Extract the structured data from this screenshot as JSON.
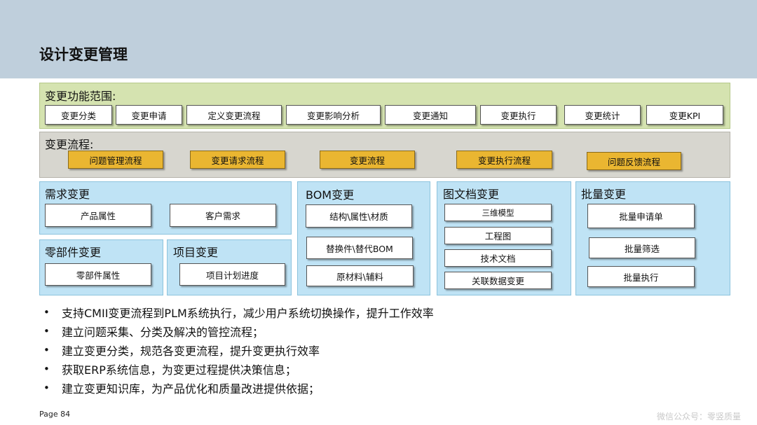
{
  "title": "设计变更管理",
  "functions": {
    "label": "变更功能范围:",
    "items": [
      "变更分类",
      "变更申请",
      "定义变更流程",
      "变更影响分析",
      "变更通知",
      "变更执行",
      "变更统计",
      "变更KPI"
    ]
  },
  "process": {
    "label": "变更流程:",
    "items": [
      "问题管理流程",
      "变更请求流程",
      "变更流程",
      "变更执行流程",
      "问题反馈流程"
    ]
  },
  "demand": {
    "title": "需求变更",
    "items": [
      "产品属性",
      "客户需求"
    ]
  },
  "parts": {
    "title": "零部件变更",
    "items": [
      "零部件属性"
    ]
  },
  "project": {
    "title": "项目变更",
    "items": [
      "项目计划进度"
    ]
  },
  "bom": {
    "title": "BOM变更",
    "items": [
      "结构\\属性\\材质",
      "替换件\\替代BOM",
      "原材料\\辅料"
    ]
  },
  "docs": {
    "title": "图文档变更",
    "items": [
      "三维模型",
      "工程图",
      "技术文档",
      "关联数据变更"
    ]
  },
  "batch": {
    "title": "批量变更",
    "items": [
      "批量申请单",
      "批量筛选",
      "批量执行"
    ]
  },
  "bullets": [
    "支持CMII变更流程到PLM系统执行，减少用户系统切换操作，提升工作效率",
    "建立问题采集、分类及解决的管控流程；",
    "建立变更分类，规范各变更流程，提升变更执行效率",
    "获取ERP系统信息，为变更过程提供决策信息；",
    "建立变更知识库，为产品优化和质量改进提供依据；"
  ],
  "bullet_symbol": "•",
  "page": "Page 84",
  "watermark": "微信公众号：零竖质量"
}
